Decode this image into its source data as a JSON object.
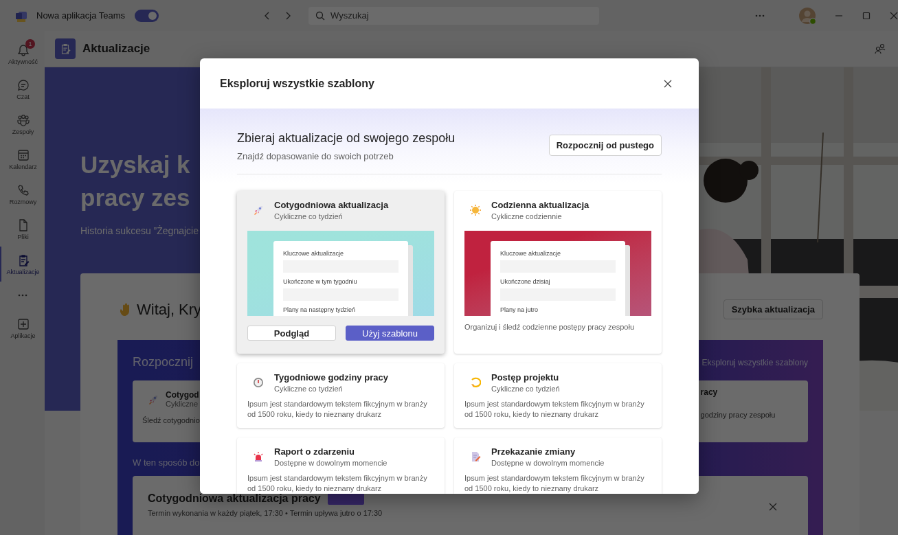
{
  "title_bar": {
    "app_name": "Nowa aplikacja Teams",
    "toggle": {
      "on": true
    },
    "search": {
      "placeholder": "Wyszukaj"
    }
  },
  "rail": {
    "items": [
      {
        "label": "Aktywność",
        "badge": "1",
        "selected": false
      },
      {
        "label": "Czat",
        "selected": false
      },
      {
        "label": "Zespoły",
        "selected": false
      },
      {
        "label": "Kalendarz",
        "selected": false
      },
      {
        "label": "Rozmowy",
        "selected": false
      },
      {
        "label": "Pliki",
        "selected": false
      },
      {
        "label": "Aktualizacje",
        "selected": true
      }
    ],
    "more_items": [
      {
        "label": "Aplikacje",
        "selected": false
      }
    ]
  },
  "header": {
    "title": "Aktualizacje"
  },
  "hero": {
    "title_lines": [
      "Uzyskaj k",
      "pracy zes"
    ],
    "subtitle": "Historia sukcesu ”Żegnajcie"
  },
  "welcome_card": {
    "greeting": "Witaj, Kry",
    "quick_update_button": "Szybka aktualizacja",
    "templates_panel": {
      "title": "Rozpocznij",
      "explore_link": "Eksploruj wszystkie szablony",
      "cards": [
        {
          "title": "Cotygod",
          "subtitle": "Cykliczne",
          "description": "Śledź cotygodnio"
        },
        {
          "title": "racy",
          "description": "godziny pracy zespołu"
        }
      ],
      "section_label": "W ten sposób do",
      "update_card": {
        "title": "Cotygodniowa aktualizacja pracy",
        "due": "Termin wykonania w każdy piątek, 17:30 • Termin upływa jutro o 17:30"
      }
    }
  },
  "dialog": {
    "title": "Eksploruj wszystkie szablony",
    "heading": "Zbieraj aktualizacje od swojego zespołu",
    "subheading": "Znajdź dopasowanie do swoich potrzeb",
    "blank_button": "Rozpocznij od pustego",
    "templates": [
      {
        "title": "Cotygodniowa aktualizacja",
        "subtitle": "Cykliczne co tydzień",
        "highlighted": true,
        "preview": {
          "color": "#9fe3dc",
          "fields": [
            "Kluczowe aktualizacje",
            "Ukończone w tym tygodniu",
            "Plany na następny tydzień"
          ]
        },
        "actions": [
          "Podgląd",
          "Użyj szablonu"
        ]
      },
      {
        "title": "Codzienna aktualizacja",
        "subtitle": "Cykliczne codziennie",
        "highlighted": false,
        "preview": {
          "color": "#c0223f",
          "fields": [
            "Kluczowe aktualizacje",
            "Ukończone dzisiaj",
            "Plany na jutro"
          ]
        },
        "description": "Organizuj i śledź codzienne postępy pracy zespołu"
      },
      {
        "title": "Tygodniowe godziny pracy",
        "subtitle": "Cykliczne co tydzień",
        "highlighted": false,
        "description": "Ipsum jest standardowym tekstem fikcyjnym w branży od 1500 roku, kiedy to nieznany drukarz"
      },
      {
        "title": "Postęp projektu",
        "subtitle": "Cykliczne co tydzień",
        "highlighted": false,
        "description": "Ipsum jest standardowym tekstem fikcyjnym w branży od 1500 roku, kiedy to nieznany drukarz"
      },
      {
        "title": "Raport o zdarzeniu",
        "subtitle": "Dostępne w dowolnym momencie",
        "highlighted": false,
        "description": "Ipsum jest standardowym tekstem fikcyjnym w branży od 1500 roku, kiedy to nieznany drukarz"
      },
      {
        "title": "Przekazanie zmiany",
        "subtitle": "Dostępne w dowolnym momencie",
        "highlighted": false,
        "description": "Ipsum jest standardowym tekstem fikcyjnym w branży od 1500 roku, kiedy to nieznany drukarz"
      }
    ]
  }
}
